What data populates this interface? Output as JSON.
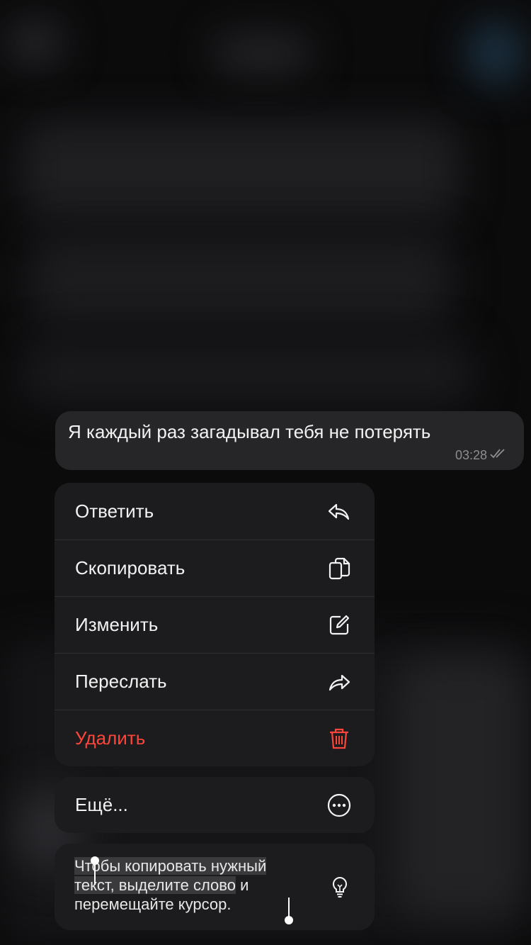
{
  "message": {
    "text": "Я каждый раз загадывал тебя не потерять",
    "time": "03:28",
    "status_icon": "double-check-icon"
  },
  "menu": {
    "items": [
      {
        "label": "Ответить",
        "icon": "reply-icon"
      },
      {
        "label": "Скопировать",
        "icon": "copy-icon"
      },
      {
        "label": "Изменить",
        "icon": "edit-icon"
      },
      {
        "label": "Переслать",
        "icon": "forward-icon"
      },
      {
        "label": "Удалить",
        "icon": "trash-icon",
        "color": "#ff453a"
      }
    ],
    "more": {
      "label": "Ещё...",
      "icon": "more-icon"
    }
  },
  "hint": {
    "line1": "Чтобы копировать нужный",
    "line2a": "текст, выделите слово",
    "line2b": " и",
    "line3": "перемещайте курсор.",
    "icon": "lightbulb-icon"
  }
}
